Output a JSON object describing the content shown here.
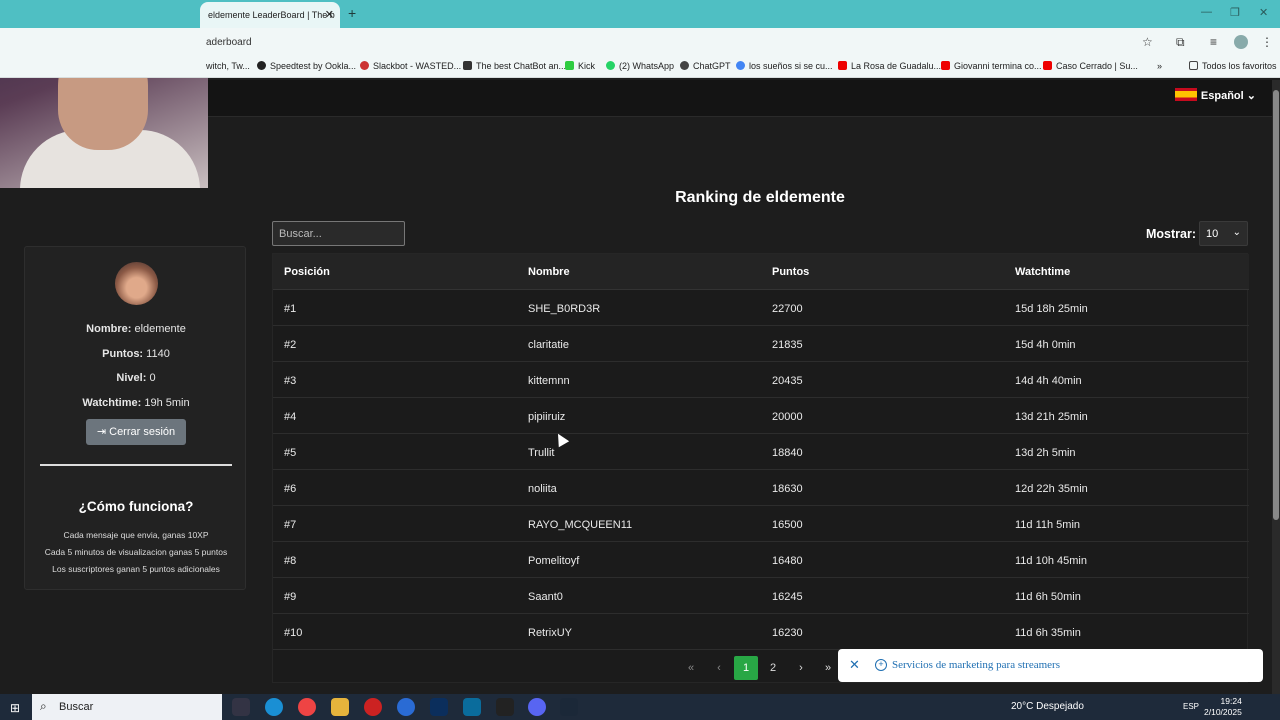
{
  "browser": {
    "tab_title": "eldemente LeaderBoard | The b",
    "address": "aderboard",
    "bookmarks": [
      "witch, Tw...",
      "Speedtest by Ookla...",
      "Slackbot - WASTED...",
      "The best ChatBot an...",
      "Kick",
      "(2) WhatsApp",
      "ChatGPT",
      "los sueños si se cu...",
      "La Rosa de Guadalu...",
      "Giovanni termina co...",
      "Caso Cerrado | Su...",
      "Todos los favoritos"
    ]
  },
  "header": {
    "language": "Español"
  },
  "profile": {
    "name_label": "Nombre:",
    "name": "eldemente",
    "points_label": "Puntos:",
    "points": "1140",
    "level_label": "Nivel:",
    "level": "0",
    "watch_label": "Watchtime:",
    "watchtime": "19h 5min",
    "logout": "Cerrar sesión"
  },
  "how": {
    "title": "¿Cómo funciona?",
    "lines": [
      "Cada mensaje que envia, ganas 10XP",
      "Cada 5 minutos de visualizacion ganas 5 puntos",
      "Los suscriptores ganan 5 puntos adicionales"
    ]
  },
  "ranking": {
    "title": "Ranking de eldemente",
    "search_placeholder": "Buscar...",
    "show_label": "Mostrar:",
    "show_value": "10",
    "columns": [
      "Posición",
      "Nombre",
      "Puntos",
      "Watchtime"
    ],
    "rows": [
      [
        "#1",
        "SHE_B0RD3R",
        "22700",
        "15d 18h 25min"
      ],
      [
        "#2",
        "claritatie",
        "21835",
        "15d 4h 0min"
      ],
      [
        "#3",
        "kittemnn",
        "20435",
        "14d 4h 40min"
      ],
      [
        "#4",
        "pipiiruiz",
        "20000",
        "13d 21h 25min"
      ],
      [
        "#5",
        "Trullit",
        "18840",
        "13d 2h 5min"
      ],
      [
        "#6",
        "noliita",
        "18630",
        "12d 22h 35min"
      ],
      [
        "#7",
        "RAYO_MCQUEEN11",
        "16500",
        "11d 11h 5min"
      ],
      [
        "#8",
        "Pomelitoyf",
        "16480",
        "11d 10h 45min"
      ],
      [
        "#9",
        "Saant0",
        "16245",
        "11d 6h 50min"
      ],
      [
        "#10",
        "RetrixUY",
        "16230",
        "11d 6h 35min"
      ]
    ],
    "pages": [
      "1",
      "2"
    ]
  },
  "toast": {
    "text": "Servicios de marketing para streamers"
  },
  "taskbar": {
    "search": "Buscar",
    "weather": "20°C  Despejado",
    "lang": "ESP",
    "time": "19:24",
    "date": "2/10/2025"
  }
}
